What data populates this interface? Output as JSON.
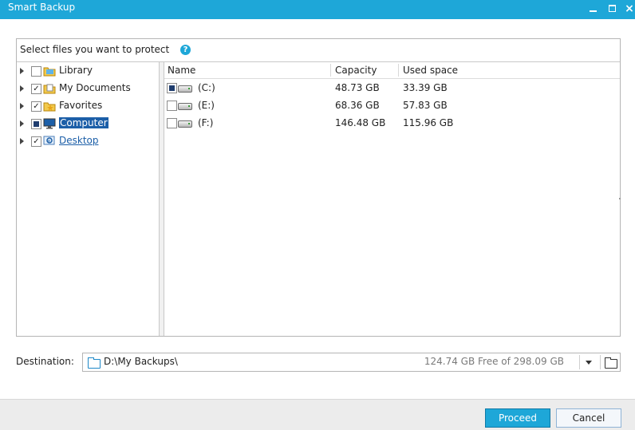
{
  "window": {
    "title": "Smart Backup",
    "controls": {
      "minimize": "minimize-icon",
      "maximize": "maximize-icon",
      "close": "×"
    }
  },
  "panel": {
    "header": "Select files you want to protect",
    "help_icon": "?"
  },
  "tree": {
    "items": [
      {
        "label": "Library",
        "checked": "unchecked",
        "icon": "library-folder-icon"
      },
      {
        "label": "My Documents",
        "checked": "checked",
        "icon": "documents-folder-icon"
      },
      {
        "label": "Favorites",
        "checked": "checked",
        "icon": "favorites-folder-icon"
      },
      {
        "label": "Computer",
        "checked": "partial",
        "icon": "computer-icon",
        "selected": true
      },
      {
        "label": "Desktop",
        "checked": "checked",
        "icon": "desktop-icon"
      }
    ]
  },
  "grid": {
    "columns": [
      "Name",
      "Capacity",
      "Used space"
    ],
    "rows": [
      {
        "name": "(C:)",
        "capacity": "48.73 GB",
        "used": "33.39 GB",
        "checked": "partial"
      },
      {
        "name": "(E:)",
        "capacity": "68.36 GB",
        "used": "57.83 GB",
        "checked": "unchecked"
      },
      {
        "name": "(F:)",
        "capacity": "146.48 GB",
        "used": "115.96 GB",
        "checked": "unchecked"
      }
    ]
  },
  "destination": {
    "label": "Destination:",
    "path": "D:\\My Backups\\",
    "free_space": "124.74 GB Free of 298.09 GB"
  },
  "buttons": {
    "proceed": "Proceed",
    "cancel": "Cancel"
  },
  "colors": {
    "accent": "#1ea7d8",
    "selection": "#1c5fa8"
  }
}
